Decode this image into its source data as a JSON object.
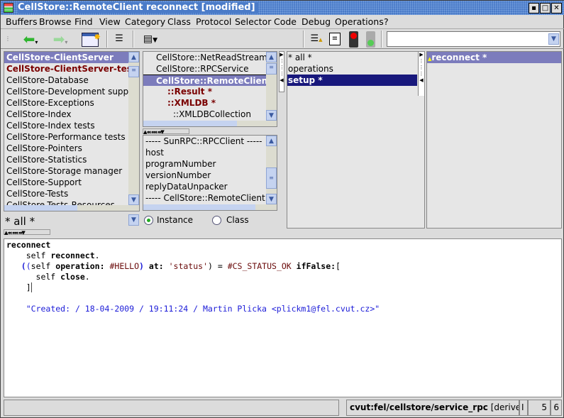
{
  "window": {
    "title": "CellStore::RemoteClient reconnect [modified]"
  },
  "menu": [
    "Buffers",
    "Browse",
    "Find",
    "View",
    "Category",
    "Class",
    "Protocol",
    "Selector",
    "Code",
    "Debug",
    "Operations",
    "?"
  ],
  "toolbar": {
    "search_value": ""
  },
  "categories": {
    "items": [
      "CellStore-ClientServer",
      "CellStore-ClientServer-tests",
      "CellStore-Database",
      "CellStore-Development suppor",
      "CellStore-Exceptions",
      "CellStore-Index",
      "CellStore-Index tests",
      "CellStore-Performance tests",
      "CellStore-Pointers",
      "CellStore-Statistics",
      "CellStore-Storage manager",
      "CellStore-Support",
      "CellStore-Tests",
      "CellStore-Tests-Resources"
    ],
    "filter": "* all *"
  },
  "classes": {
    "items": [
      "CellStore::NetReadStream",
      "CellStore::RPCService",
      "CellStore::RemoteClient *",
      "::Result *",
      "::XMLDB *",
      "::XMLDBCollection"
    ]
  },
  "variables": {
    "items": [
      "----- SunRPC::RPCClient -----",
      "host",
      "programNumber",
      "versionNumber",
      "replyDataUnpacker",
      "----- CellStore::RemoteClient -----"
    ]
  },
  "class_side": {
    "instance_label": "Instance",
    "class_label": "Class",
    "selected": "Instance"
  },
  "protocols": {
    "items": [
      "* all *",
      "operations",
      "setup *"
    ]
  },
  "methods": {
    "items": [
      "reconnect *"
    ]
  },
  "code": {
    "l1": "reconnect",
    "l2a": "    self ",
    "l2b": "reconnect",
    ".": ".",
    "l3a": "(",
    "l3b": "(",
    "l3c": "self ",
    "l3d": "operation:",
    "l3e": " #HELLO",
    "l3f": ")",
    "l3g": " at:",
    "l3h": " 'status'",
    "l3i": ") = ",
    "l3j": "#CS_STATUS_OK",
    "l3k": " ifFalse:",
    "l3l": "[",
    "l4a": "self ",
    "l4b": "close",
    "l5": "]",
    "comment": "\"Created: / 18-04-2009 / 19:11:24 / Martin Plicka <plickm1@fel.cvut.cz>\""
  },
  "status": {
    "package": "cvut:fel/cellstore/service_rpc",
    "derived": "[derived fro",
    "mode": "I",
    "line": "5",
    "col": "6"
  }
}
